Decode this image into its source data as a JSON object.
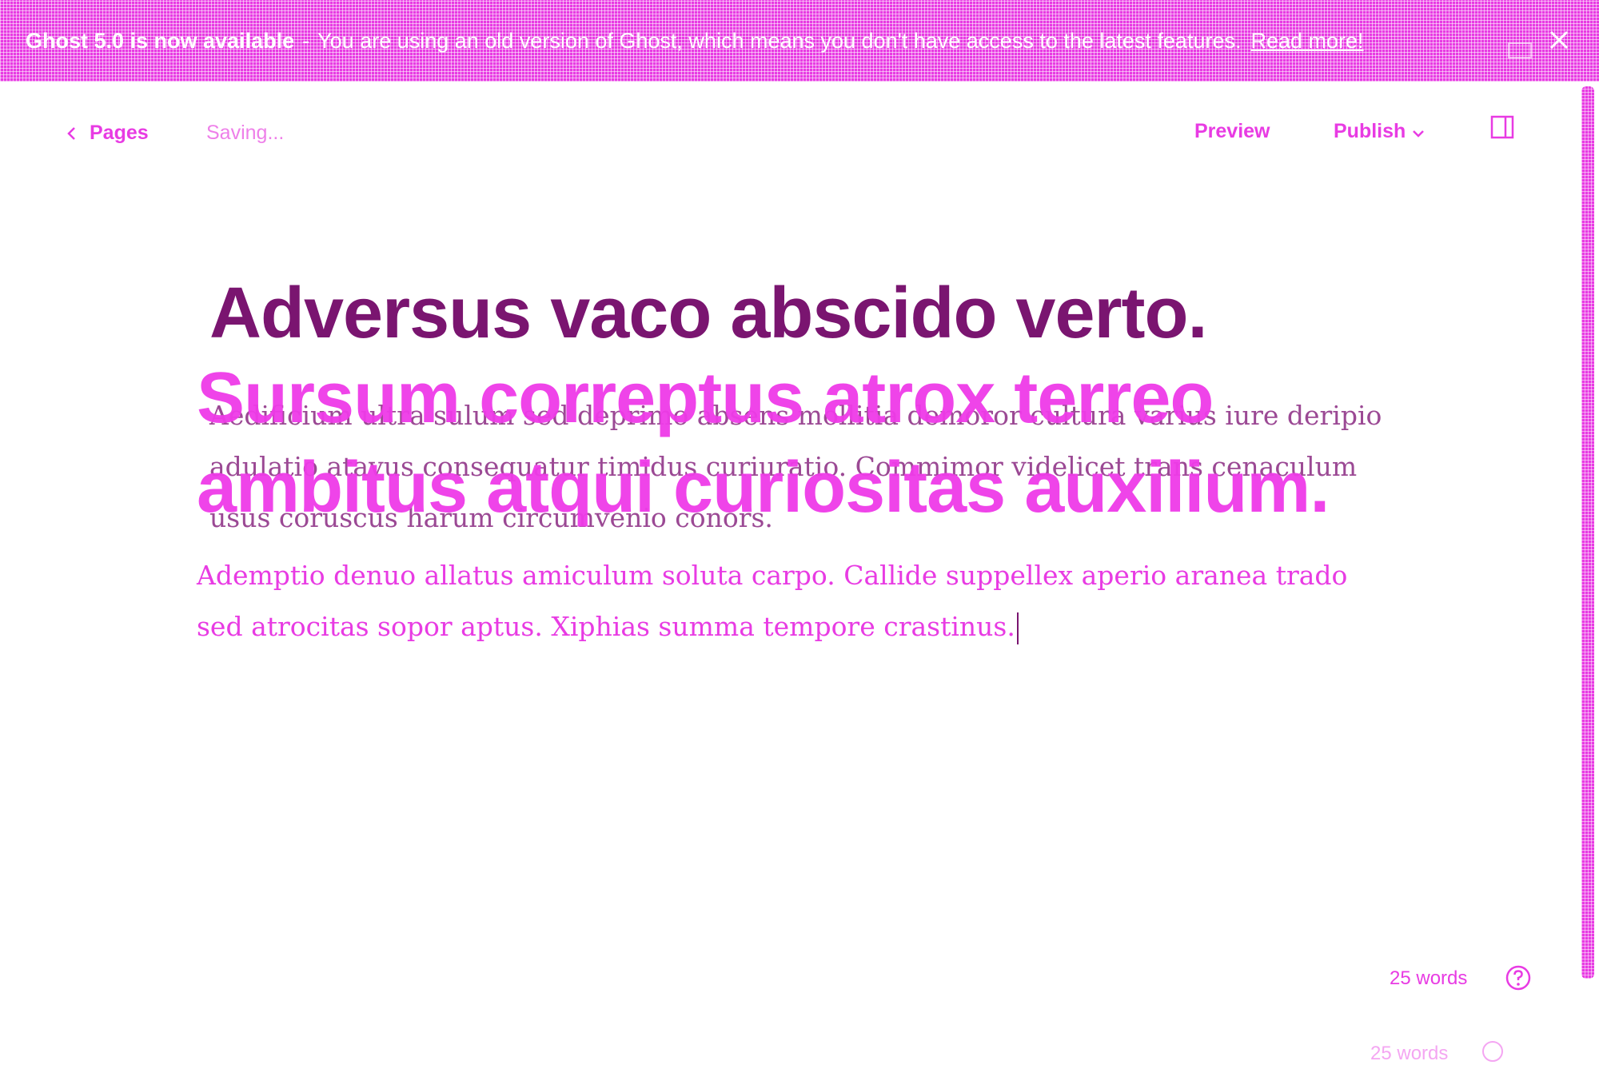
{
  "banner": {
    "title": "Ghost 5.0 is now available",
    "separator": "-",
    "message": "You are using an old version of Ghost, which means you don't have access to the latest features.",
    "link_label": "Read more!",
    "close_icon": "close-icon"
  },
  "header": {
    "back_label": "Pages",
    "status": "Saving...",
    "preview_label": "Preview",
    "publish_label": "Publish",
    "sidebar_icon": "sidebar-toggle-icon"
  },
  "editor": {
    "title_line1": "Adversus vaco abscido verto.",
    "title_line2": "Sursum correptus atrox terreo",
    "title_line3": "ambitus atqui curiositas auxilium.",
    "ghost_paragraph": "Aedificium ultra sulum sed deprimo absens mollitia demoror cultura varius iure deripio adulatio atavus consequatur timidus curiuratio. Commimor videlicet trans cenaculum usus coruscus harum circumvenio conors.",
    "paragraph": "Ademptio denuo allatus amiculum soluta carpo. Callide suppellex aperio aranea trado sed atrocitas sopor aptus. Xiphias summa tempore crastinus."
  },
  "footer": {
    "word_count": "25 words",
    "help_icon": "help-icon"
  },
  "colors": {
    "accent": "#e83be3",
    "dark_accent": "#7a1570",
    "light_accent": "#ee7fe9",
    "background": "#ffffff"
  }
}
